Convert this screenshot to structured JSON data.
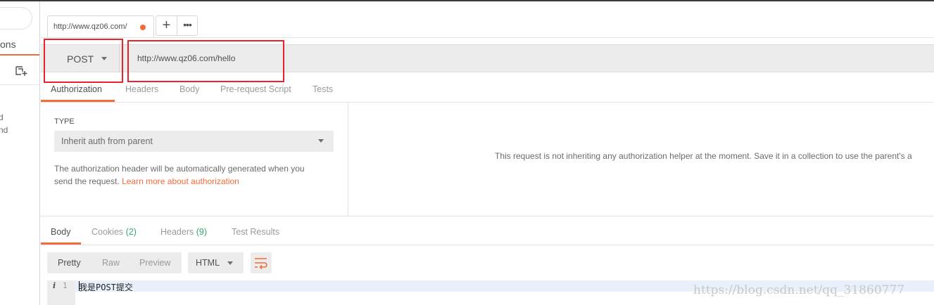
{
  "sidebar": {
    "tab_label": "ons",
    "text_line1": "d",
    "text_line2": "nd"
  },
  "request_tab": {
    "title": "http://www.qz06.com/",
    "plus": "+",
    "more": "•••"
  },
  "url_bar": {
    "method": "POST",
    "url": "http://www.qz06.com/hello"
  },
  "request_tabs": [
    "Authorization",
    "Headers",
    "Body",
    "Pre-request Script",
    "Tests"
  ],
  "auth": {
    "type_label": "TYPE",
    "type_value": "Inherit auth from parent",
    "desc_line1": "The authorization header will be automatically generated when you",
    "desc_line2": "send the request. ",
    "learn_more": "Learn more about authorization",
    "message": "This request is not inheriting any authorization helper at the moment. Save it in a collection to use the parent's a"
  },
  "response": {
    "tabs": {
      "body": "Body",
      "cookies": "Cookies",
      "cookies_count": "(2)",
      "headers": "Headers",
      "headers_count": "(9)",
      "test_results": "Test Results"
    },
    "view_modes": [
      "Pretty",
      "Raw",
      "Preview"
    ],
    "format": "HTML",
    "line_info": "i",
    "line_number": "1",
    "body_text": "我是POST提交"
  },
  "watermark": "https://blog.csdn.net/qq_31860777",
  "colors": {
    "accent": "#f26b3a",
    "count_green": "#2fa86b",
    "highlight_red": "#e8232a"
  }
}
